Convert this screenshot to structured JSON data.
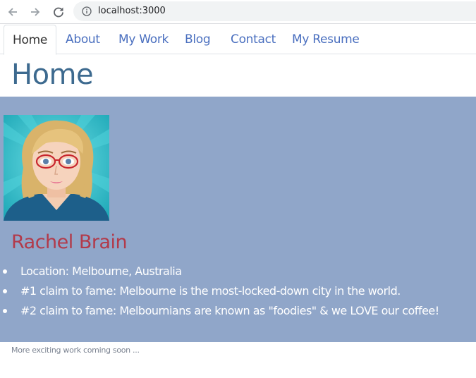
{
  "browser": {
    "url": "localhost:3000"
  },
  "nav": {
    "tabs": [
      {
        "label": "Home",
        "active": true
      },
      {
        "label": "About",
        "active": false
      },
      {
        "label": "My Work",
        "active": false
      },
      {
        "label": "Blog",
        "active": false
      },
      {
        "label": "Contact",
        "active": false
      },
      {
        "label": "My Resume",
        "active": false
      }
    ]
  },
  "page": {
    "title": "Home"
  },
  "profile": {
    "name": "Rachel Brain",
    "facts": [
      "Location: Melbourne, Australia",
      "#1 claim to fame: Melbourne is the most-locked-down city in the world.",
      "#2 claim to fame: Melbournians are known as \"foodies\" & we LOVE our coffee!"
    ]
  },
  "footer": {
    "note": "More exciting work coming soon ..."
  },
  "colors": {
    "panel_background": "#90a6c9",
    "nav_link": "#4a6fbf",
    "title": "#3d6a8f",
    "name": "#b23a4a"
  }
}
